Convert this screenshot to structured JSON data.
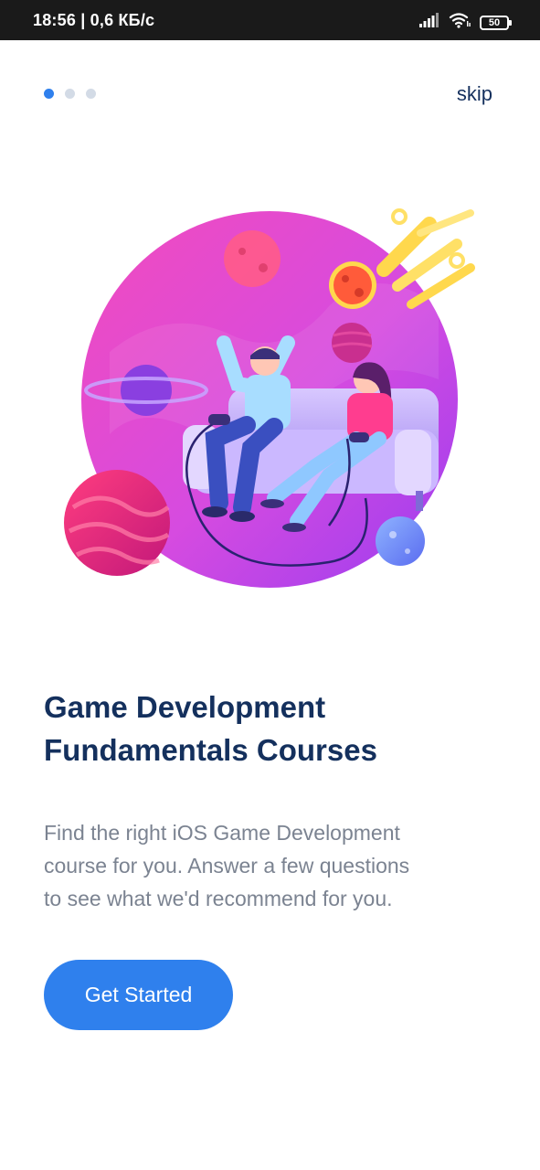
{
  "status_bar": {
    "time": "18:56 | 0,6 КБ/с",
    "battery_level": "50",
    "icons": [
      "signal-icon",
      "wifi-icon",
      "battery-icon"
    ]
  },
  "onboarding": {
    "skip_label": "skip",
    "current_page": 1,
    "total_pages": 3,
    "title_lines": [
      "Game Development",
      "Fundamentals Courses"
    ],
    "description_lines": [
      "Find the right iOS Game Development",
      "course for you. Answer a few questions",
      "to see what we'd recommend for you."
    ],
    "cta_label": "Get Started"
  },
  "colors": {
    "accent": "#2f80ed",
    "title": "#14305d",
    "body_text": "#7b8391",
    "inactive_dot": "#d3dbe6",
    "status_bar": "#1a1a1a"
  }
}
